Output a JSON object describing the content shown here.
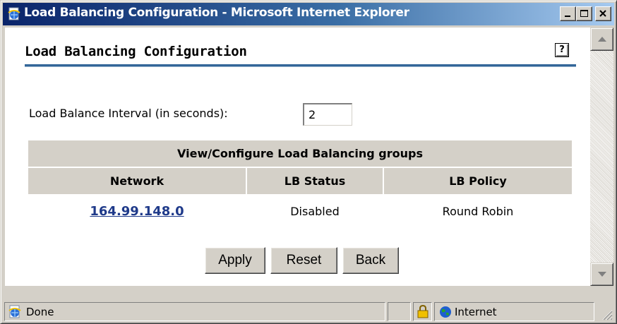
{
  "window": {
    "title": "Load Balancing Configuration - Microsoft Internet Explorer",
    "icon": "ie-page-icon"
  },
  "page": {
    "title": "Load Balancing Configuration",
    "help_label": "?"
  },
  "interval": {
    "label": "Load Balance Interval (in seconds):",
    "value": "2"
  },
  "table": {
    "caption": "View/Configure Load Balancing groups",
    "headers": [
      "Network",
      "LB Status",
      "LB Policy"
    ],
    "rows": [
      {
        "network": "164.99.148.0",
        "status": "Disabled",
        "policy": "Round Robin"
      }
    ]
  },
  "buttons": {
    "apply": "Apply",
    "reset": "Reset",
    "back": "Back"
  },
  "statusbar": {
    "text": "Done",
    "zone": "Internet"
  },
  "colors": {
    "titlebar_start": "#0a246a",
    "titlebar_end": "#a6caf0",
    "link": "#1f3a8a",
    "title_rule": "#336699",
    "header_bg": "#d4d0c8"
  }
}
